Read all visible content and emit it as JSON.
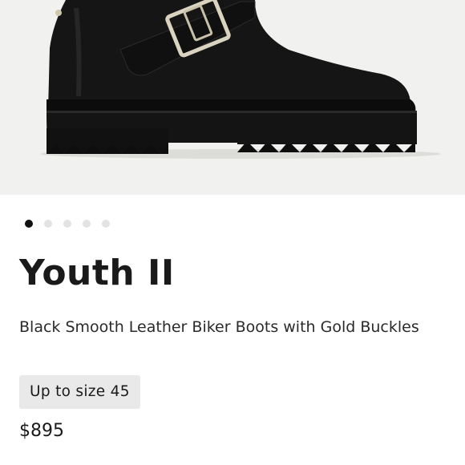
{
  "product": {
    "image_alt": "Youth II black leather biker boot",
    "carousel": {
      "total": 5,
      "active": 1
    },
    "name": "Youth II",
    "description": "Black Smooth Leather Biker Boots with Gold Buckles",
    "size_badge": "Up to size 45",
    "price": "$895"
  },
  "colors": {
    "hero_bg": "#f1f1ef",
    "boot_black": "#121212",
    "buckle_gold": "#d9d3c0",
    "dot_active": "#111111",
    "dot_inactive": "#e3e3e3",
    "badge_bg": "#e9e9e9"
  }
}
